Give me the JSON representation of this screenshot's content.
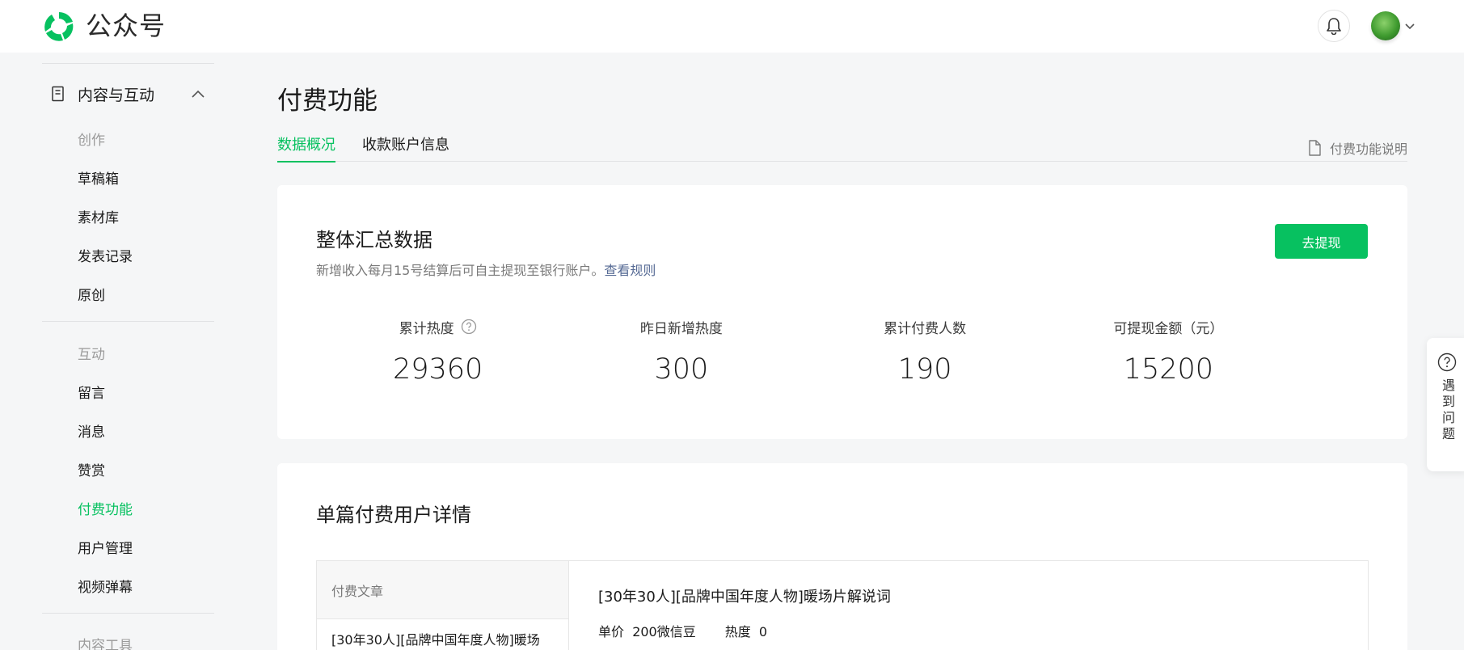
{
  "header": {
    "brand": "公众号",
    "logo_icon": "wechat-official-account-logo-icon",
    "notification_icon": "bell-icon",
    "avatar_icon": "avatar-icon",
    "account_menu_icon": "chevron-down-icon"
  },
  "sidebar": {
    "group_label": "内容与互动",
    "group_icon": "document-icon",
    "collapse_icon": "chevron-up-icon",
    "section_create": "创作",
    "create_items": [
      "草稿箱",
      "素材库",
      "发表记录",
      "原创"
    ],
    "section_interact": "互动",
    "interact_items": [
      "留言",
      "消息",
      "赞赏",
      "付费功能",
      "用户管理",
      "视频弹幕"
    ],
    "active_item": "付费功能",
    "section_tools": "内容工具"
  },
  "main": {
    "page_title": "付费功能",
    "tabs": [
      "数据概况",
      "收款账户信息"
    ],
    "active_tab": "数据概况",
    "help_link": "付费功能说明",
    "help_link_icon": "file-icon"
  },
  "summary": {
    "title": "整体汇总数据",
    "desc": "新增收入每月15号结算后可自主提现至银行账户。",
    "rule_link": "查看规则",
    "withdraw_button": "去提现",
    "stats": [
      {
        "label": "累计热度",
        "value": "29360"
      },
      {
        "label": "昨日新增热度",
        "value": "300"
      },
      {
        "label": "累计付费人数",
        "value": "190"
      },
      {
        "label": "可提现金额（元）",
        "value": "15200"
      }
    ],
    "help_icon": "question-circle-icon"
  },
  "detail": {
    "title": "单篇付费用户详情",
    "col_header": "付费文章",
    "row_article": "[30年30人][品牌中国年度人物]暖场",
    "article_title": "[30年30人][品牌中国年度人物]暖场片解说词",
    "price_label": "单价",
    "price_value": "200微信豆",
    "heat_label": "热度",
    "heat_value": "0"
  },
  "float_help": {
    "text": "遇到问题",
    "icon": "question-circle-icon"
  },
  "colors": {
    "accent": "#07c160",
    "link": "#576b95",
    "background": "#f5f6f7"
  }
}
